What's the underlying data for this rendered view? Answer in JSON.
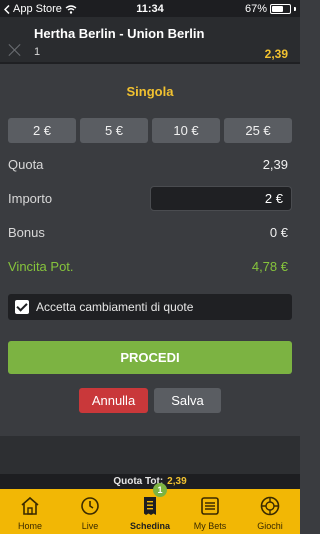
{
  "status_bar": {
    "carrier": "App Store",
    "time": "11:34",
    "battery": "67%",
    "battery_level": 0.67
  },
  "event": {
    "title": "Hertha Berlin - Union Berlin",
    "selection": "1",
    "odd": "2,39"
  },
  "bet_type": "Singola",
  "stake_buttons": [
    "2 €",
    "5 €",
    "10 €",
    "25 €"
  ],
  "rows": {
    "quota": {
      "label": "Quota",
      "value": "2,39"
    },
    "importo": {
      "label": "Importo",
      "value": "2 €"
    },
    "bonus": {
      "label": "Bonus",
      "value": "0 €"
    },
    "vincita": {
      "label": "Vincita Pot.",
      "value": "4,78 €"
    }
  },
  "accept_changes": {
    "label": "Accetta cambiamenti di quote",
    "checked": true
  },
  "buttons": {
    "procedi": "PROCEDI",
    "annulla": "Annulla",
    "salva": "Salva"
  },
  "quota_tot": {
    "label": "Quota Tot:",
    "value": "2,39"
  },
  "tabs": [
    {
      "label": "Home",
      "icon": "home-icon"
    },
    {
      "label": "Live",
      "icon": "clock-icon"
    },
    {
      "label": "Schedina",
      "icon": "receipt-icon",
      "badge": "1",
      "active": true
    },
    {
      "label": "My Bets",
      "icon": "list-icon"
    },
    {
      "label": "Giochi",
      "icon": "roulette-icon"
    }
  ],
  "colors": {
    "accent": "#f2c230",
    "green": "#7cb342",
    "red": "#c9383a",
    "tabbar": "#f2b705"
  }
}
